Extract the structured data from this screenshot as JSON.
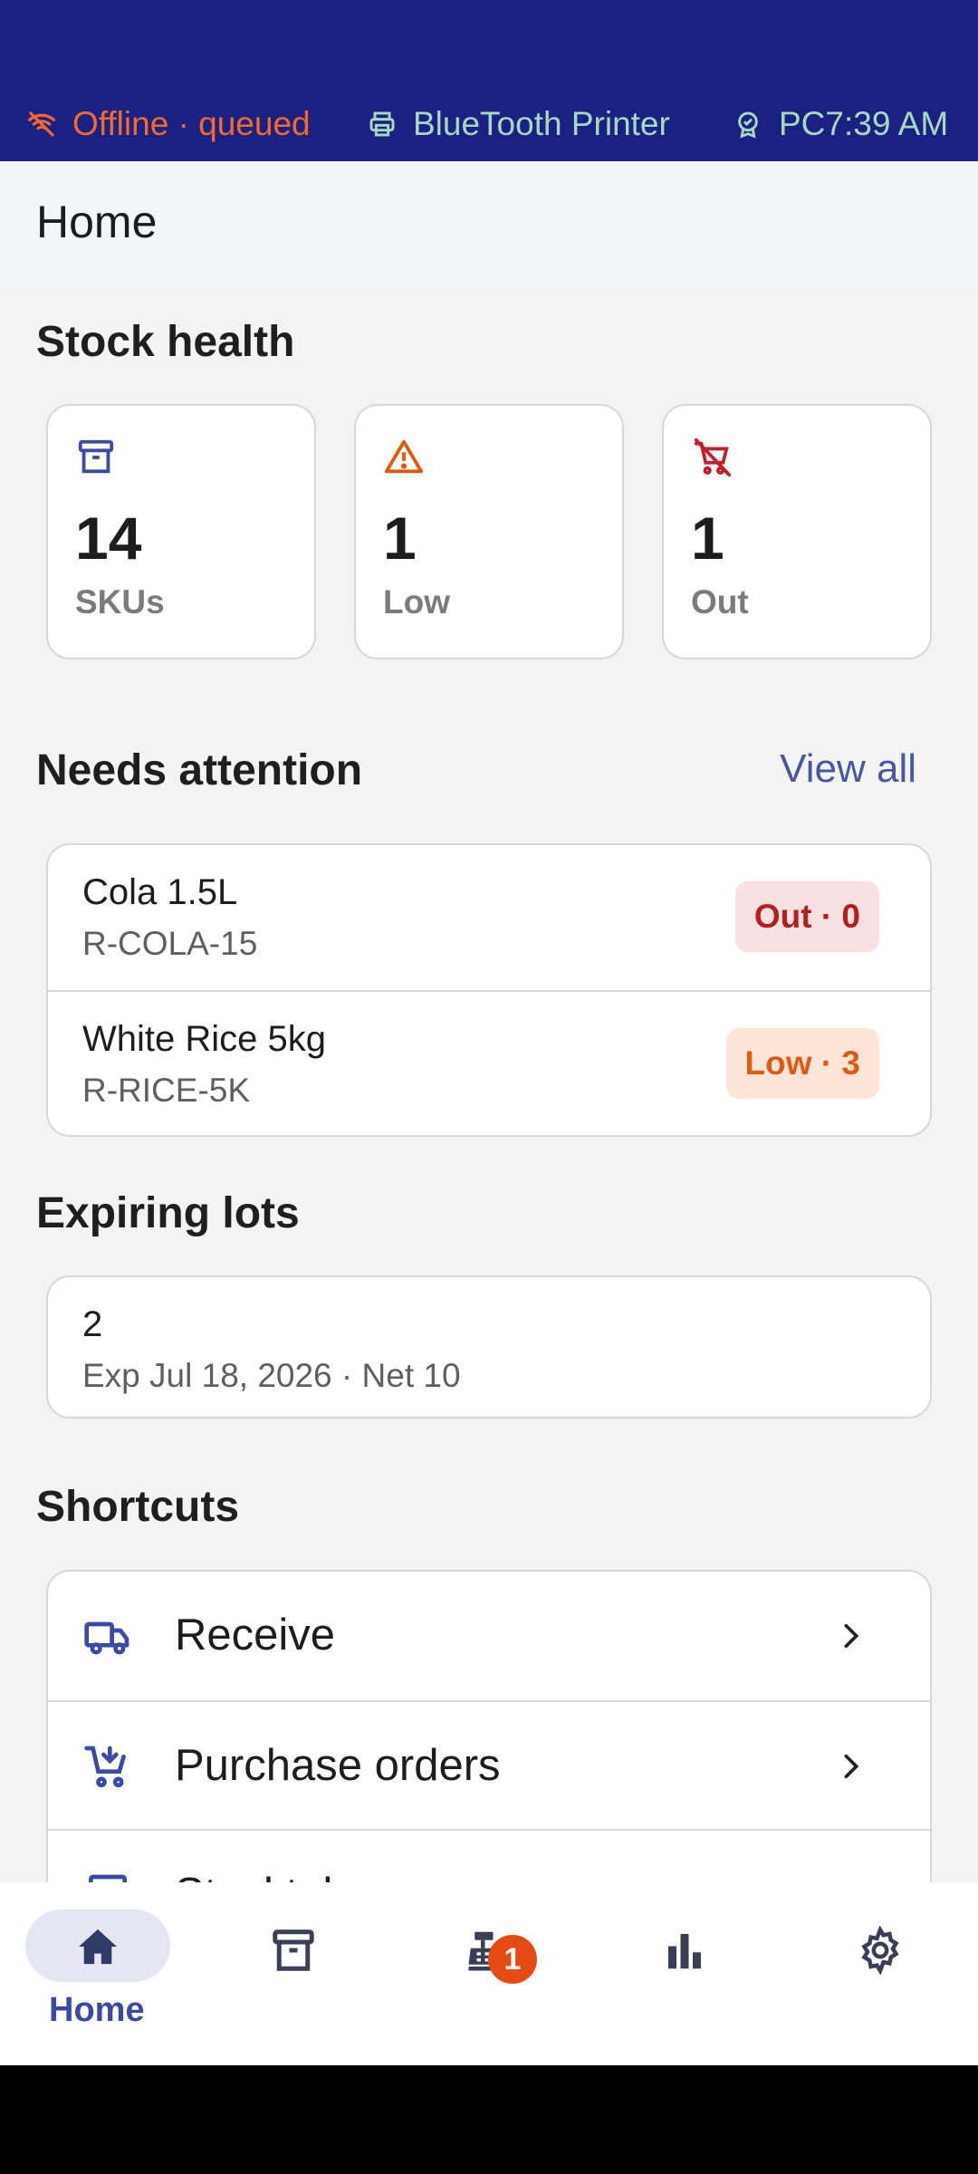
{
  "status_bar": {
    "offline": "Offline · queued",
    "printer": "BlueTooth Printer",
    "device": "PC",
    "time": "7:39 AM",
    "icons": {
      "offline": "wifi-off-icon",
      "printer": "printer-icon",
      "device": "badge-icon"
    }
  },
  "header": {
    "title": "Home"
  },
  "stock_health": {
    "title": "Stock health",
    "cards": [
      {
        "value": "14",
        "label": "SKUs",
        "icon": "archive-box-icon",
        "color": "#3d4aa5"
      },
      {
        "value": "1",
        "label": "Low",
        "icon": "warning-triangle-icon",
        "color": "#e05a14"
      },
      {
        "value": "1",
        "label": "Out",
        "icon": "cart-off-icon",
        "color": "#c0202f"
      }
    ]
  },
  "needs_attention": {
    "title": "Needs attention",
    "view_all": "View all",
    "items": [
      {
        "name": "Cola 1.5L",
        "sku": "R-COLA-15",
        "badge": "Out · 0",
        "status": "out"
      },
      {
        "name": "White Rice 5kg",
        "sku": "R-RICE-5K",
        "badge": "Low · 3",
        "status": "low"
      }
    ]
  },
  "expiring_lots": {
    "title": "Expiring lots",
    "items": [
      {
        "qty": "2",
        "detail": "Exp Jul 18, 2026 · Net 10"
      }
    ]
  },
  "shortcuts": {
    "title": "Shortcuts",
    "items": [
      {
        "label": "Receive",
        "icon": "truck-icon"
      },
      {
        "label": "Purchase orders",
        "icon": "cart-add-icon"
      },
      {
        "label": "Stocktake",
        "icon": "clipboard-icon"
      }
    ]
  },
  "bottom_nav": {
    "items": [
      {
        "label": "Home",
        "icon": "home-icon",
        "active": true
      },
      {
        "label": "",
        "icon": "inventory-icon",
        "active": false
      },
      {
        "label": "",
        "icon": "cash-register-icon",
        "active": false,
        "badge": "1"
      },
      {
        "label": "",
        "icon": "bar-chart-icon",
        "active": false
      },
      {
        "label": "",
        "icon": "settings-gear-icon",
        "active": false
      }
    ]
  },
  "colors": {
    "status_bar_bg": "#1b2183",
    "accent": "#3d4aa5",
    "warning": "#e05a14",
    "danger": "#c0202f",
    "link": "#4a57a0"
  }
}
